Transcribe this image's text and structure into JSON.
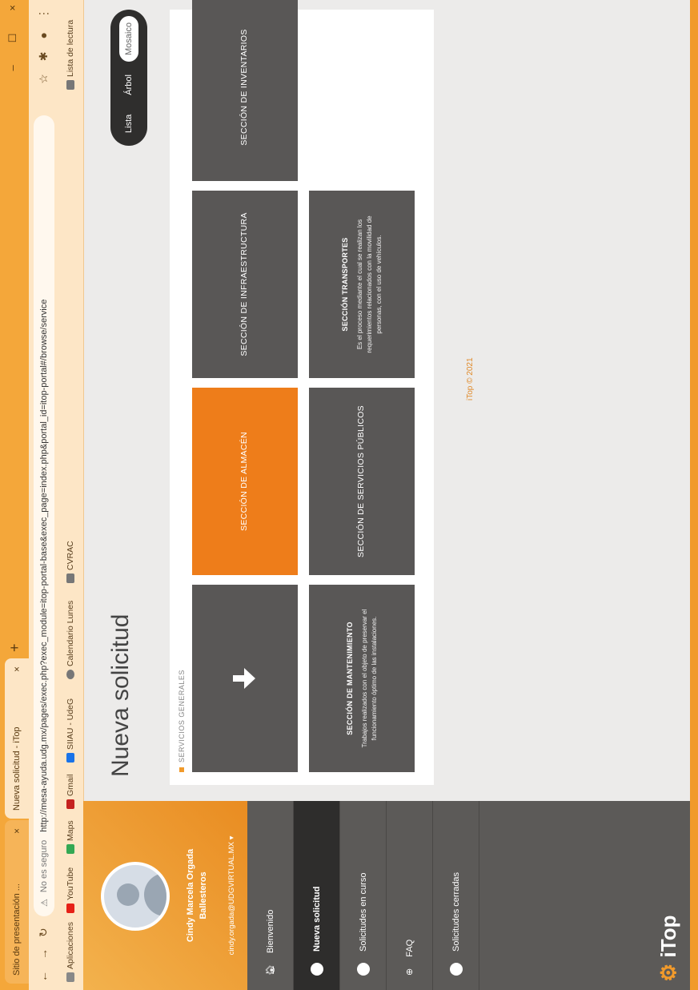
{
  "browser": {
    "tabs": [
      {
        "label": "Sitio de presentación ...",
        "close": "×"
      },
      {
        "label": "Nueva solicitud - iTop",
        "close": "×"
      }
    ],
    "new_tab": "+",
    "window_buttons": [
      "–",
      "☐",
      "×"
    ],
    "address": {
      "secure_label": "No es seguro",
      "url": "http://mesa-ayuda.udg.mx/pages/exec.php?exec_module=itop-portal-base&exec_page=index.php&portal_id=itop-portal#/browse/service"
    },
    "bookmarks": [
      {
        "label": "Aplicaciones",
        "color": "#888888"
      },
      {
        "label": "YouTube",
        "color": "#e62117"
      },
      {
        "label": "Maps",
        "color": "#34a853"
      },
      {
        "label": "Gmail",
        "color": "#c5221f"
      },
      {
        "label": "SIIAU - UdeG",
        "color": "#1a73e8"
      },
      {
        "label": "Calendario Lunes",
        "color": "#777777"
      },
      {
        "label": "CVRAC",
        "color": "#777777"
      }
    ],
    "reading_list": "Lista de lectura"
  },
  "sidebar": {
    "user_name_1": "Cindy Marcela Orgada",
    "user_name_2": "Ballesteros",
    "user_email": "cindy.orgada@UDGVIRTUAL.MX",
    "menu": [
      {
        "label": "Bienvenido",
        "active": false
      },
      {
        "label": "Nueva solicitud",
        "active": true
      },
      {
        "label": "Solicitudes en curso",
        "active": false
      },
      {
        "label": "FAQ",
        "active": false
      },
      {
        "label": "Solicitudes cerradas",
        "active": false
      }
    ],
    "brand": "iTop"
  },
  "main": {
    "title": "Nueva solicitud",
    "view_switch": [
      {
        "label": "Lista",
        "selected": false
      },
      {
        "label": "Árbol",
        "selected": false
      },
      {
        "label": "Mosaico",
        "selected": true
      }
    ],
    "breadcrumb": "SERVICIOS GENERALES",
    "tiles": [
      {
        "label": "",
        "icon": "arrow-down-icon",
        "accent": false
      },
      {
        "label": "SECCIÓN DE ALMACÉN",
        "accent": true
      },
      {
        "label": "SECCIÓN DE INFRAESTRUCTURA",
        "accent": false
      },
      {
        "label": "SECCIÓN DE INVENTARIOS",
        "accent": false
      },
      {
        "label": "SECCIÓN DE MANTENIMIENTO",
        "desc": "Trabajos realizados con el objeto de preservar el funcionamiento óptimo de las instalaciones.",
        "accent": false
      },
      {
        "label": "SECCIÓN DE SERVICIOS PÚBLICOS",
        "accent": false
      },
      {
        "label": "SECCIÓN TRANSPORTES",
        "desc": "Es el proceso mediante el cual se realizan los requerimientos relacionados con la movilidad de personas, con el uso de vehículos.",
        "accent": false
      }
    ],
    "footer": "iTop © 2021"
  }
}
